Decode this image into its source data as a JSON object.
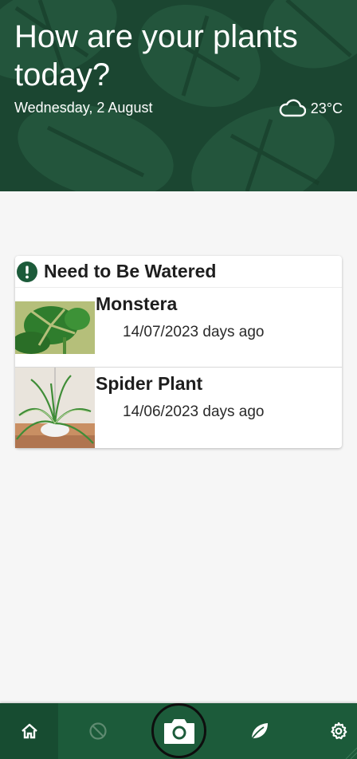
{
  "header": {
    "title": "How are your plants today?",
    "date": "Wednesday, 2 August",
    "weather_icon": "cloud-icon",
    "temperature": "23°C"
  },
  "water_card": {
    "title": "Need to Be Watered",
    "icon": "alert-icon",
    "plants": [
      {
        "name": "Monstera",
        "watered": "14/07/2023 days ago"
      },
      {
        "name": "Spider Plant",
        "watered": "14/06/2023 days ago"
      }
    ]
  },
  "nav": {
    "items": [
      "home-icon",
      "block-icon",
      "camera-icon",
      "leaf-icon",
      "gear-icon"
    ]
  },
  "colors": {
    "primary": "#1c5b3a",
    "header_bg": "#1c4a33",
    "background": "#f6f6f6"
  }
}
